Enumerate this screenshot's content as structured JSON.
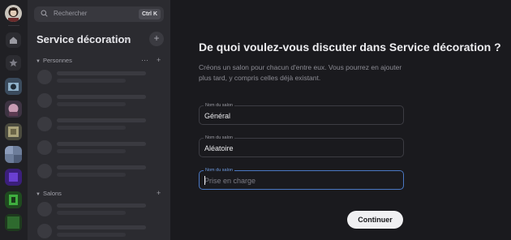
{
  "sidebar": {
    "search_placeholder": "Rechercher",
    "search_shortcut": "Ctrl K",
    "server_name": "Service décoration",
    "add_label": "+",
    "sections": [
      {
        "label": "Personnes",
        "more": "···",
        "add": "+"
      },
      {
        "label": "Salons",
        "add": "+"
      }
    ]
  },
  "main": {
    "heading": "De quoi voulez-vous discuter dans Service décoration ?",
    "description": "Créons un salon pour chacun d'entre eux. Vous pourrez en ajouter plus tard, y compris celles déjà existant.",
    "fields": [
      {
        "label": "Nom du salon",
        "value": "Général"
      },
      {
        "label": "Nom du salon",
        "value": "Aléatoire"
      },
      {
        "label": "Nom du salon",
        "placeholder": "Prise en charge"
      }
    ],
    "continue_label": "Continuer"
  },
  "colors": {
    "accent_focus": "#4a78c4",
    "button_bg": "#f0f0f2",
    "main_bg": "#1a1a1e",
    "sidebar_bg": "#2b2b30"
  },
  "icons": [
    "avatar",
    "home-icon",
    "star-icon",
    "search-icon",
    "chevron-down-icon"
  ]
}
